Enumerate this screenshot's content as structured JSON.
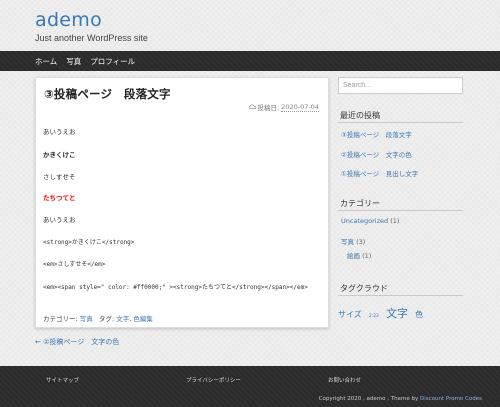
{
  "site": {
    "title": "ademo",
    "description": "Just another WordPress site"
  },
  "nav": {
    "items": [
      "ホーム",
      "写真",
      "プロフィール"
    ]
  },
  "post": {
    "title": "③投稿ページ　段落文字",
    "date_label": "投稿日:",
    "date_value": "2020-07-04",
    "lines": [
      "あいうえお",
      "かきくけこ",
      "さしすせそ",
      "たちつてと",
      "あいうえお",
      "<strong>かきくけこ</strong>",
      "<em>さしすせそ</em>",
      "<em><span style=\" color: #ff0000;\" ><strong>たちつてと</strong></span></em>"
    ],
    "meta": {
      "category_label": "カテゴリー:",
      "category": "写真",
      "tag_label": "タグ:",
      "tags": [
        "文字",
        "色編集"
      ]
    }
  },
  "prev_link": "← ②投稿ページ　文字の色",
  "sidebar": {
    "search_placeholder": "Search...",
    "recent": {
      "title": "最近の投稿",
      "items": [
        "③投稿ページ　段落文字",
        "②投稿ページ　文字の色",
        "①投稿ページ　見出し文字"
      ]
    },
    "categories": {
      "title": "カテゴリー",
      "items": [
        {
          "name": "Uncategorized",
          "count": "(1)"
        },
        {
          "name": "写真",
          "count": "(3)"
        },
        {
          "name": "絵画",
          "count": "(1)"
        }
      ]
    },
    "tags": {
      "title": "タグクラウド",
      "items": [
        {
          "name": "サイズ",
          "size": 9
        },
        {
          "name": "2:22",
          "size": 5
        },
        {
          "name": "文字",
          "size": 12
        },
        {
          "name": "色",
          "size": 9
        }
      ]
    }
  },
  "footer": {
    "links": [
      "サイトマップ",
      "プライバシーポリシー",
      "お問い合わせ"
    ],
    "copyright": "Copyright 2020 , ademo , Theme by",
    "theme_link": "Discount Promo Codes"
  },
  "colors": {
    "accent": "#3a78b5",
    "emphasis_red": "#ff0000",
    "nav_bg": "#2b2b2b",
    "page_bg": "#efefef"
  }
}
